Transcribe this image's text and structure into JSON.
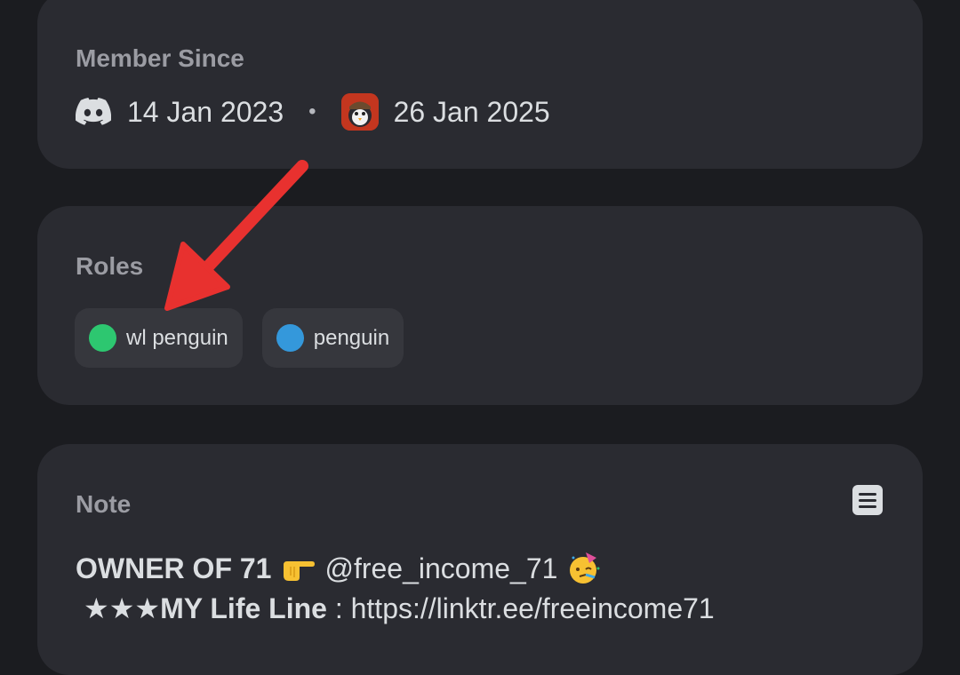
{
  "member_since": {
    "heading": "Member Since",
    "discord_date": "14 Jan 2023",
    "separator": "•",
    "server_date": "26 Jan 2025"
  },
  "roles": {
    "heading": "Roles",
    "items": [
      {
        "label": "wl penguin",
        "color": "#2dc770"
      },
      {
        "label": "penguin",
        "color": "#3498db"
      }
    ]
  },
  "note": {
    "heading": "Note",
    "line1_bold": "OWNER OF 71",
    "line1_emoji1": "pointing-right-hand",
    "line1_handle": "@free_income_71",
    "line1_emoji2": "partying-face",
    "line2_stars": "★★★",
    "line2_bold": "MY Life Line",
    "line2_rest": " : https://linktr.ee/freeincome71"
  },
  "colors": {
    "background": "#1b1c20",
    "card": "#2a2b31",
    "pill": "#36373d",
    "annotation_arrow": "#e8312f"
  }
}
